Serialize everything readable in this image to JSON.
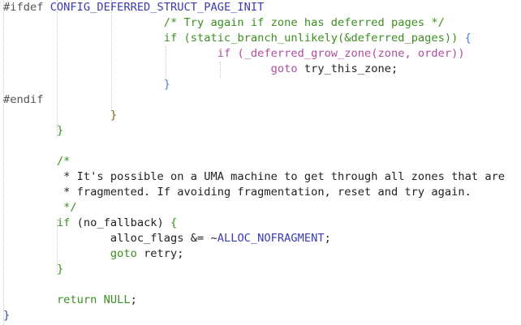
{
  "editor": {
    "lines": [
      {
        "tokens": [
          {
            "text": "#ifdef ",
            "role": "preprocessor"
          },
          {
            "text": "CONFIG_DEFERRED_STRUCT_PAGE_INIT",
            "role": "macro"
          }
        ]
      },
      {
        "tokens": [
          {
            "text": "                        ",
            "role": "text"
          },
          {
            "text": "/* Try again if zone has deferred pages */",
            "role": "comment"
          }
        ]
      },
      {
        "tokens": [
          {
            "text": "                        ",
            "role": "text"
          },
          {
            "text": "if",
            "role": "keyword"
          },
          {
            "text": " ",
            "role": "text"
          },
          {
            "text": "(static_branch_unlikely(&deferred_pages))",
            "role": "keyword"
          },
          {
            "text": " ",
            "role": "text"
          },
          {
            "text": "{",
            "role": "brace-blue"
          }
        ]
      },
      {
        "tokens": [
          {
            "text": "                                ",
            "role": "text"
          },
          {
            "text": "if",
            "role": "pink"
          },
          {
            "text": " ",
            "role": "text"
          },
          {
            "text": "(_deferred_grow_zone(zone, order))",
            "role": "pink"
          }
        ]
      },
      {
        "tokens": [
          {
            "text": "                                        ",
            "role": "text"
          },
          {
            "text": "goto",
            "role": "pink"
          },
          {
            "text": " try_this_zone;",
            "role": "text"
          }
        ]
      },
      {
        "tokens": [
          {
            "text": "                        ",
            "role": "text"
          },
          {
            "text": "}",
            "role": "brace-blue"
          }
        ]
      },
      {
        "tokens": [
          {
            "text": "#endif",
            "role": "preprocessor"
          }
        ]
      },
      {
        "tokens": [
          {
            "text": "                ",
            "role": "text"
          },
          {
            "text": "}",
            "role": "brace-brown"
          }
        ]
      },
      {
        "tokens": [
          {
            "text": "        ",
            "role": "text"
          },
          {
            "text": "}",
            "role": "brace-green"
          }
        ]
      },
      {
        "tokens": [
          {
            "text": "",
            "role": "text"
          }
        ]
      },
      {
        "tokens": [
          {
            "text": "        ",
            "role": "text"
          },
          {
            "text": "/*",
            "role": "comment"
          }
        ]
      },
      {
        "tokens": [
          {
            "text": "         ",
            "role": "text"
          },
          {
            "text": "* It's possible on a UMA machine to get through all zones that are",
            "role": "text"
          }
        ]
      },
      {
        "tokens": [
          {
            "text": "         ",
            "role": "text"
          },
          {
            "text": "* fragmented. If avoiding fragmentation, reset and try again.",
            "role": "text"
          }
        ]
      },
      {
        "tokens": [
          {
            "text": "         ",
            "role": "text"
          },
          {
            "text": "*/",
            "role": "comment"
          }
        ]
      },
      {
        "tokens": [
          {
            "text": "        ",
            "role": "text"
          },
          {
            "text": "if",
            "role": "keyword"
          },
          {
            "text": " (no_fallback) ",
            "role": "text"
          },
          {
            "text": "{",
            "role": "brace-green"
          }
        ]
      },
      {
        "tokens": [
          {
            "text": "                ",
            "role": "text"
          },
          {
            "text": "alloc_flags &= ~",
            "role": "text"
          },
          {
            "text": "ALLOC_NOFRAGMENT",
            "role": "macro"
          },
          {
            "text": ";",
            "role": "text"
          }
        ]
      },
      {
        "tokens": [
          {
            "text": "                ",
            "role": "text"
          },
          {
            "text": "goto",
            "role": "keyword"
          },
          {
            "text": " retry;",
            "role": "text"
          }
        ]
      },
      {
        "tokens": [
          {
            "text": "        ",
            "role": "text"
          },
          {
            "text": "}",
            "role": "brace-green"
          }
        ]
      },
      {
        "tokens": [
          {
            "text": "",
            "role": "text"
          }
        ]
      },
      {
        "tokens": [
          {
            "text": "        ",
            "role": "text"
          },
          {
            "text": "return",
            "role": "keyword"
          },
          {
            "text": " ",
            "role": "text"
          },
          {
            "text": "NULL",
            "role": "keyword"
          },
          {
            "text": ";",
            "role": "text"
          }
        ]
      },
      {
        "tokens": [
          {
            "text": "}",
            "role": "brace-navy"
          }
        ]
      }
    ]
  },
  "colors": {
    "background": "#ffffff",
    "preprocessor": "#555555",
    "macro": "#3b3bb0",
    "keyword": "#3c8f21",
    "comment": "#3c8f21",
    "text": "#222222",
    "brace-blue": "#4a7fd6",
    "brace-brown": "#8a5a1f",
    "brace-green": "#3c8f21",
    "brace-navy": "#2b4aa8",
    "pink": "#ae4d9c"
  }
}
